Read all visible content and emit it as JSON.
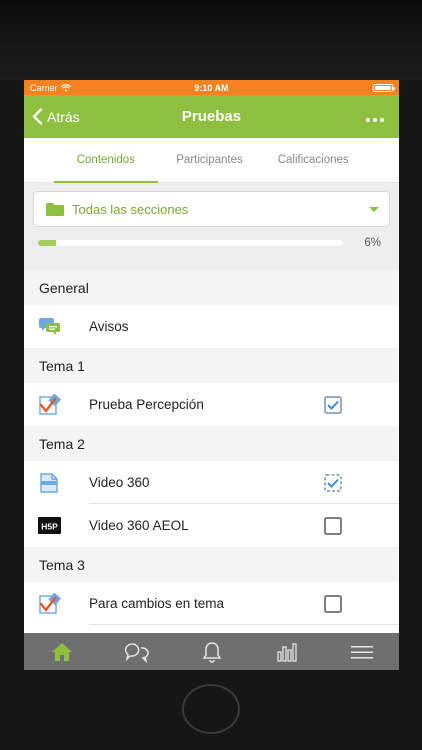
{
  "statusbar": {
    "carrier": "Carrier",
    "time": "9:10 AM"
  },
  "navbar": {
    "back_label": "Atrás",
    "title": "Pruebas"
  },
  "tabs": [
    {
      "label": "Contenidos",
      "active": true
    },
    {
      "label": "Participantes",
      "active": false
    },
    {
      "label": "Calificaciones",
      "active": false
    }
  ],
  "section_filter": {
    "label": "Todas las secciones",
    "icon": "folder-icon"
  },
  "progress": {
    "percent": 6,
    "label": "6%"
  },
  "sections": [
    {
      "name": "General",
      "items": [
        {
          "name": "Avisos",
          "icon": "forum-icon",
          "check": "none"
        }
      ]
    },
    {
      "name": "Tema 1",
      "items": [
        {
          "name": "Prueba Percepción",
          "icon": "quiz-icon",
          "check": "manual-checked"
        }
      ]
    },
    {
      "name": "Tema 2",
      "items": [
        {
          "name": "Video 360",
          "icon": "page-icon",
          "check": "auto-checked"
        },
        {
          "name": "Video 360 AEOL",
          "icon": "h5p-icon",
          "check": "unchecked"
        }
      ]
    },
    {
      "name": "Tema 3",
      "items": [
        {
          "name": "Para cambios en tema",
          "icon": "quiz-icon",
          "check": "unchecked"
        }
      ]
    }
  ],
  "bottom_tabs": [
    "home-icon",
    "chat-icon",
    "bell-icon",
    "grades-icon",
    "menu-icon"
  ],
  "colors": {
    "status_bar": "#f5821f",
    "accent": "#8ebf3f",
    "tab_bar": "#6f6f6f"
  }
}
